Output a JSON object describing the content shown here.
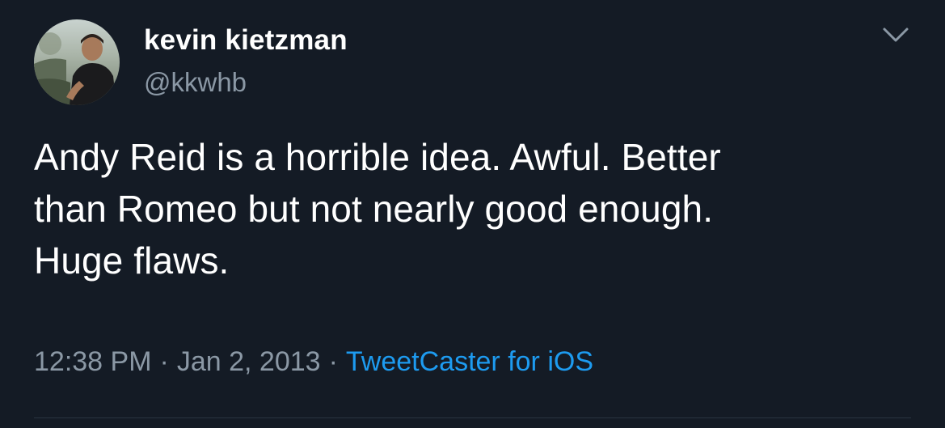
{
  "tweet": {
    "author": {
      "name": "kevin kietzman",
      "handle": "@kkwhb"
    },
    "text": "Andy Reid is a horrible idea.  Awful.  Better\nthan Romeo but not nearly good enough.\nHuge flaws.",
    "time": "12:38 PM",
    "date": "Jan 2, 2013",
    "separator": "·",
    "source": "TweetCaster for iOS"
  },
  "icons": {
    "menu": "chevron-down-icon",
    "avatar": "avatar-photo"
  },
  "colors": {
    "background": "#141b25",
    "text": "#ffffff",
    "muted": "#8b98a5",
    "link": "#1d9bf0"
  }
}
